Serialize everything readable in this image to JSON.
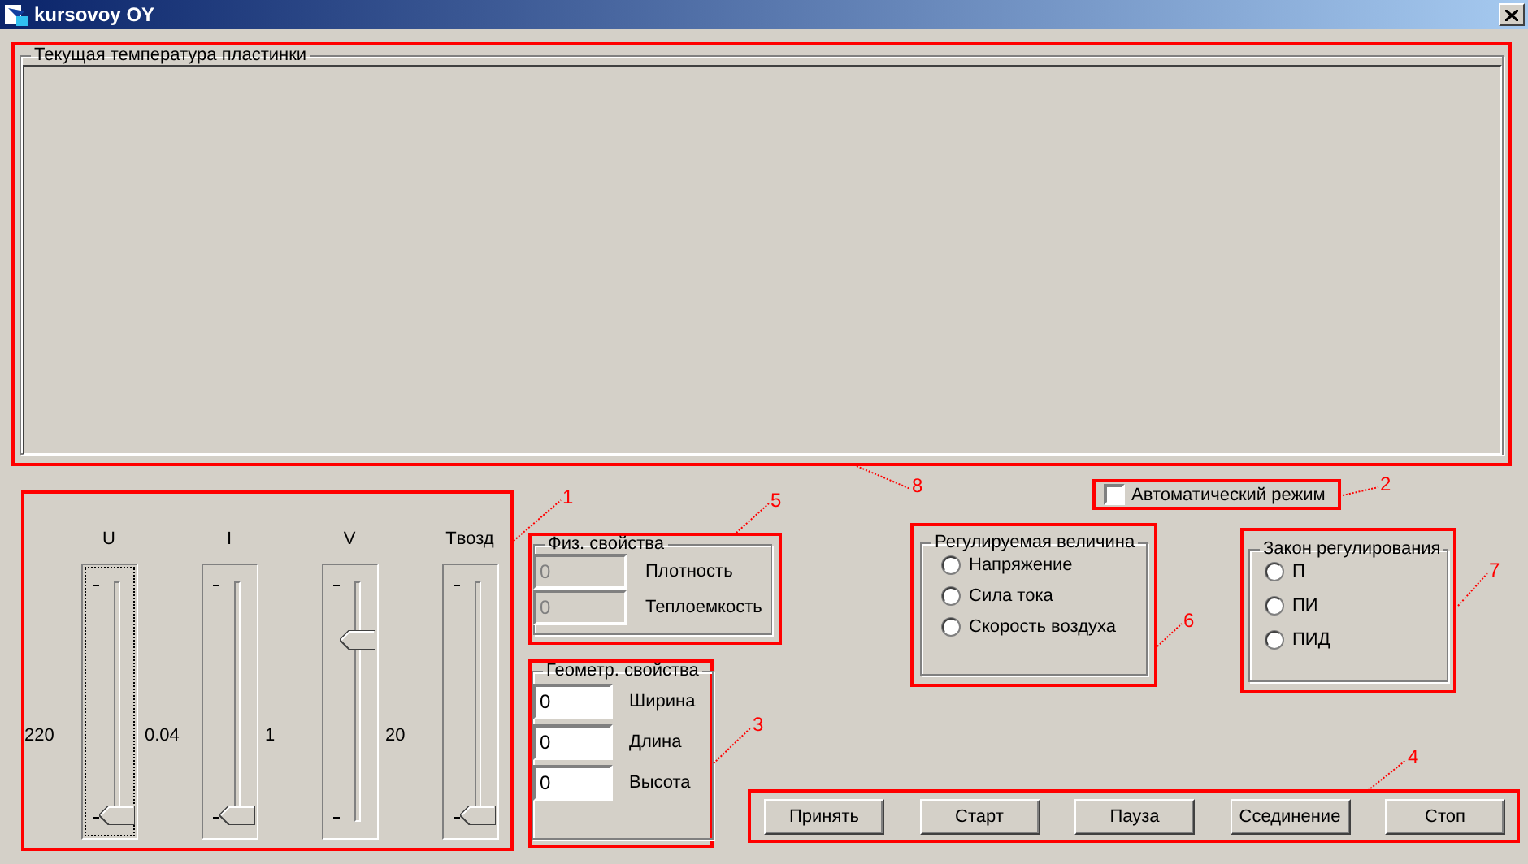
{
  "window": {
    "title": "kursovoy OY"
  },
  "temperature_panel": {
    "title": "Текущая температура пластинки",
    "annotation": "8"
  },
  "sliders_panel": {
    "annotation": "1",
    "items": [
      {
        "kind": "reading",
        "text": "220"
      },
      {
        "kind": "slider",
        "label": "U",
        "level": 0,
        "focused": true
      },
      {
        "kind": "reading",
        "text": "0.04"
      },
      {
        "kind": "slider",
        "label": "I",
        "level": 0,
        "focused": false
      },
      {
        "kind": "reading",
        "text": "1"
      },
      {
        "kind": "slider",
        "label": "V",
        "level": 0.77,
        "focused": false
      },
      {
        "kind": "reading",
        "text": "20"
      },
      {
        "kind": "slider",
        "label": "Tвозд",
        "level": 0,
        "focused": false
      }
    ]
  },
  "phys_props": {
    "title": "Физ. свойства",
    "annotation": "5",
    "fields": [
      {
        "value": "0",
        "label": "Плотность",
        "disabled": true
      },
      {
        "value": "0",
        "label": "Теплоемкость",
        "disabled": true
      }
    ]
  },
  "geom_props": {
    "title": "Геометр. свойства",
    "annotation": "3",
    "fields": [
      {
        "value": "0",
        "label": "Ширина",
        "disabled": false
      },
      {
        "value": "0",
        "label": "Длина",
        "disabled": false
      },
      {
        "value": "0",
        "label": "Высота",
        "disabled": false
      }
    ]
  },
  "auto_mode": {
    "label": "Автоматический режим",
    "checked": false,
    "annotation": "2"
  },
  "controlled_variable": {
    "title": "Регулируемая величина",
    "annotation": "6",
    "options": [
      {
        "label": "Напряжение",
        "selected": false
      },
      {
        "label": "Сила тока",
        "selected": false
      },
      {
        "label": "Скорость воздуха",
        "selected": false
      }
    ]
  },
  "control_law": {
    "title": "Закон регулирования",
    "annotation": "7",
    "options": [
      {
        "label": "П",
        "selected": false
      },
      {
        "label": "ПИ",
        "selected": false
      },
      {
        "label": "ПИД",
        "selected": false
      }
    ]
  },
  "buttons": {
    "annotation": "4",
    "items": [
      {
        "label": "Принять"
      },
      {
        "label": "Старт"
      },
      {
        "label": "Пауза"
      },
      {
        "label": "Ссединение"
      },
      {
        "label": "Стоп"
      }
    ]
  }
}
